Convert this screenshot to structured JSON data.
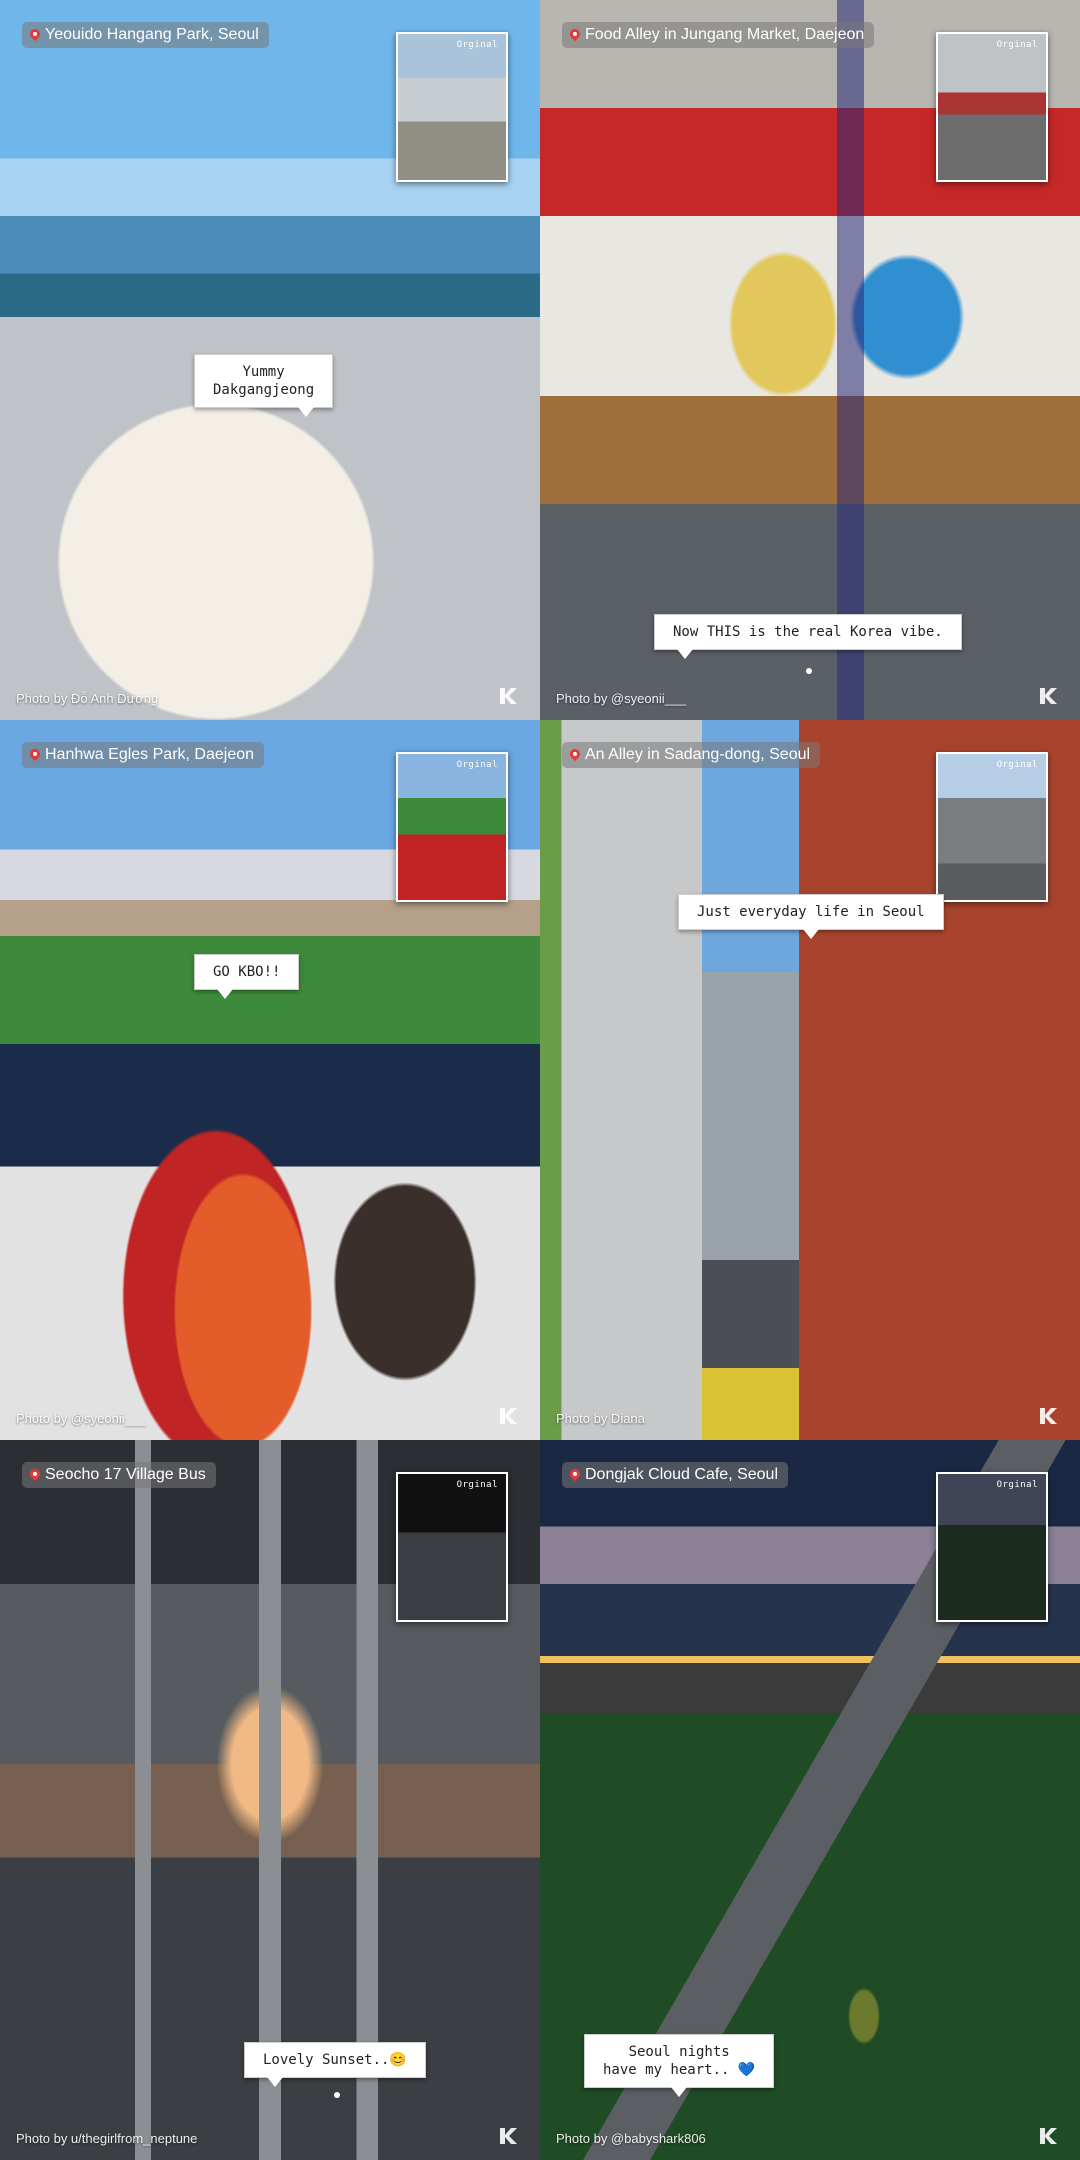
{
  "tiles": [
    {
      "location": "Yeouido Hangang Park, Seoul",
      "inset_label": "Orginal",
      "bubble": "Yummy\nDakgangjeong",
      "credit": "Photo by Đỗ Anh Dương"
    },
    {
      "location": "Food Alley in Jungang Market, Daejeon",
      "inset_label": "Orginal",
      "bubble": "Now THIS is the real Korea vibe.",
      "credit": "Photo by @syeonii___"
    },
    {
      "location": "Hanhwa Egles Park, Daejeon",
      "inset_label": "Orginal",
      "bubble": "GO KBO!!",
      "credit": "Photo by @syeonii___"
    },
    {
      "location": "An Alley in Sadang-dong, Seoul",
      "inset_label": "Orginal",
      "bubble": "Just everyday life in Seoul",
      "credit": "Photo by Diana"
    },
    {
      "location": "Seocho 17 Village Bus",
      "inset_label": "Orginal",
      "bubble": "Lovely Sunset..😊",
      "credit": "Photo by u/thegirlfrom_neptune"
    },
    {
      "location": "Dongjak Cloud Cafe, Seoul",
      "inset_label": "Orginal",
      "bubble": "Seoul nights\nhave my heart.. 💙",
      "credit": "Photo by @babyshark806"
    }
  ],
  "icons": {
    "pin": "location-pin-icon",
    "logo": "brand-logo-icon"
  }
}
